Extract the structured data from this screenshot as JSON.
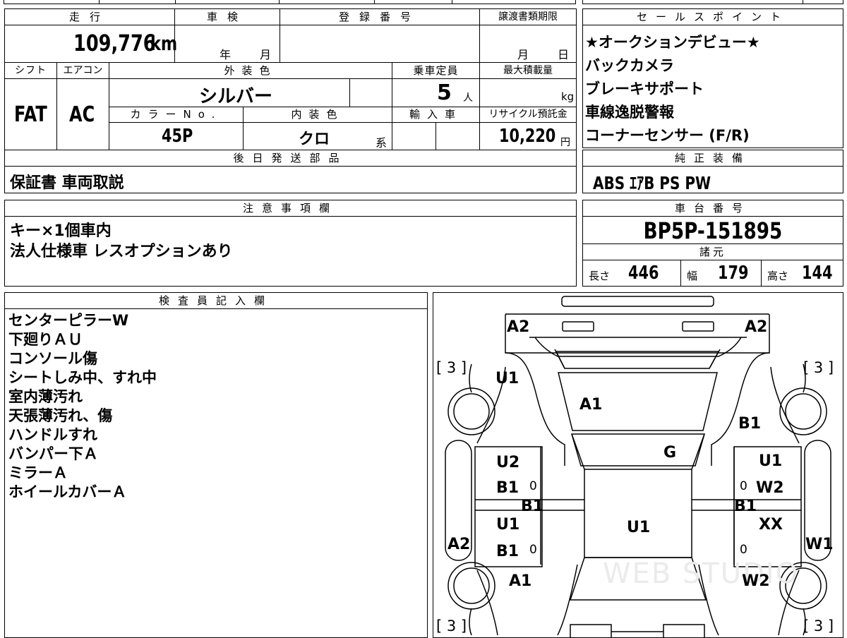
{
  "summary": {
    "mileage_label": "走行",
    "mileage_value": "109,776",
    "mileage_unit": "km",
    "shaken_label": "車検",
    "shaken_year_unit": "年",
    "shaken_month_unit": "月",
    "registration_label": "登録番号",
    "transfer_label": "譲渡書類期限",
    "transfer_month_unit": "月",
    "transfer_day_unit": "日",
    "shift_label": "シフト",
    "shift_value": "FAT",
    "ac_label": "エアコン",
    "ac_value": "AC",
    "exterior_label": "外装色",
    "exterior_value": "シルバー",
    "capacity_label": "乗車定員",
    "capacity_value": "5",
    "capacity_unit": "人",
    "maxload_label": "最大積載量",
    "maxload_unit": "kg",
    "colorno_label": "カラーNo.",
    "colorno_value": "45P",
    "interior_label": "内装色",
    "interior_value": "クロ",
    "interior_suffix": "系",
    "import_label": "輸入車",
    "recycle_label": "リサイクル預託金",
    "recycle_value": "10,220",
    "recycle_unit": "円",
    "later_parts_label": "後日発送部品",
    "later_parts_value": "保証書 車両取説"
  },
  "sales_points": {
    "label": "セールスポイント",
    "items": [
      "★オークションデビュー★",
      "バックカメラ",
      "ブレーキサポート",
      "車線逸脱警報",
      "コーナーセンサー (F/R)"
    ]
  },
  "genuine_equipment": {
    "label": "純正装備",
    "value": "ABS ｴｱB PS PW"
  },
  "notes": {
    "label": "注意事項欄",
    "lines": [
      "キー×1個車内",
      "法人仕様車 レスオプションあり"
    ]
  },
  "chassis": {
    "label": "車台番号",
    "value": "BP5P-151895"
  },
  "dimensions": {
    "label": "諸元",
    "length_label": "長さ",
    "length_value": "446",
    "width_label": "幅",
    "width_value": "179",
    "height_label": "高さ",
    "height_value": "144"
  },
  "inspector": {
    "label": "検査員記入欄",
    "lines": [
      "センターピラーW",
      "下廻りＡＵ",
      "コンソール傷",
      "シートしみ中、すれ中",
      "室内薄汚れ",
      "天張薄汚れ、傷",
      "ハンドルすれ",
      "バンパー下Ａ",
      "ミラーＡ",
      "ホイールカバーＡ"
    ]
  },
  "diagram": {
    "marks": [
      "A2",
      "A2",
      "[ 3 ]",
      "[ 3 ]",
      "U1",
      "A1",
      "B1",
      "G",
      "U2",
      "B1",
      "0",
      "U1",
      "0",
      "W2",
      "B1",
      "B1",
      "U1",
      "U1",
      "XX",
      "A2",
      "B1",
      "0",
      "0",
      "W1",
      "A1",
      "W2",
      "[ 3 ]",
      "[ 3 ]"
    ],
    "watermark": "WEB STUDIO"
  }
}
